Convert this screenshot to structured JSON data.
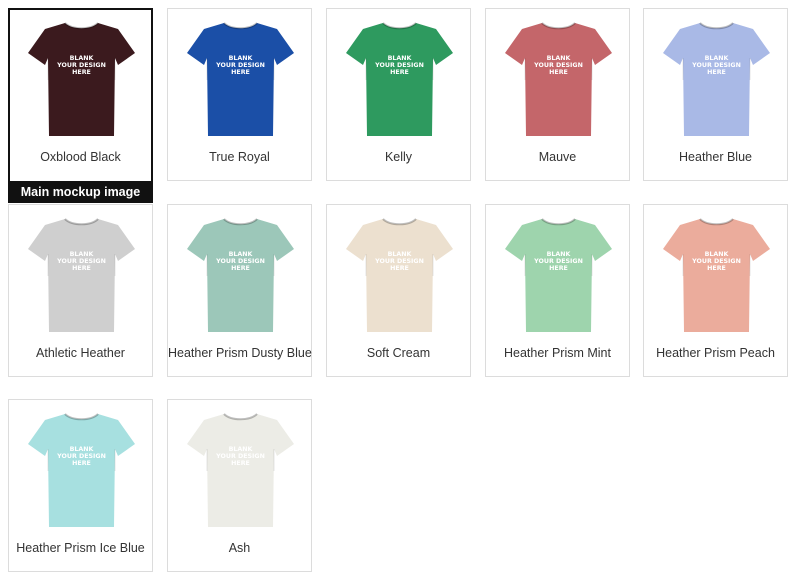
{
  "mockups": [
    {
      "name": "Oxblood Black",
      "color": "#3b1a1e",
      "selected": true
    },
    {
      "name": "True Royal",
      "color": "#1b4fa7"
    },
    {
      "name": "Kelly",
      "color": "#2e9a5f"
    },
    {
      "name": "Mauve",
      "color": "#c4666a"
    },
    {
      "name": "Heather Blue",
      "color": "#a9b9e6"
    },
    {
      "name": "Athletic Heather",
      "color": "#cfcfcf"
    },
    {
      "name": "Heather Prism Dusty Blue",
      "color": "#9cc7b9"
    },
    {
      "name": "Soft Cream",
      "color": "#ece0cf"
    },
    {
      "name": "Heather Prism Mint",
      "color": "#9ed4ad"
    },
    {
      "name": "Heather Prism Peach",
      "color": "#ebac9c"
    },
    {
      "name": "Heather Prism Ice Blue",
      "color": "#a7e0e0"
    },
    {
      "name": "Ash",
      "color": "#ecece6"
    }
  ],
  "main_tag": "Main mockup image",
  "shirt_print": [
    "BLANK",
    "YOUR DESIGN",
    "HERE"
  ]
}
